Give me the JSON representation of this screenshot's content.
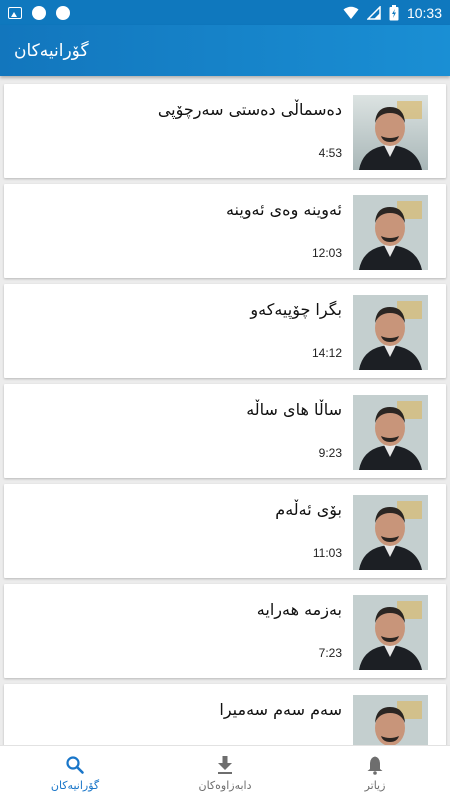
{
  "status_bar": {
    "time": "10:33"
  },
  "app_bar": {
    "title": "گۆرانیەکان"
  },
  "songs": [
    {
      "title": "دەسماڵی دەستی سەرچۆپی",
      "duration": "4:53"
    },
    {
      "title": "ئەوینە وەی ئەوینە",
      "duration": "12:03"
    },
    {
      "title": "بگرا چۆپیەکەو",
      "duration": "14:12"
    },
    {
      "title": "ساڵا های ساڵە",
      "duration": "9:23"
    },
    {
      "title": "بۆی ئەڵەم",
      "duration": "11:03"
    },
    {
      "title": "بەزمە هەرایە",
      "duration": "7:23"
    },
    {
      "title": "سەم سەم سەمیرا",
      "duration": ""
    }
  ],
  "bottom_nav": {
    "songs": "گۆرانیەکان",
    "downloads": "دابەزاوەکان",
    "more": "زیاتر"
  },
  "colors": {
    "accent": "#1976c9",
    "app_bar": "#1276bd"
  }
}
